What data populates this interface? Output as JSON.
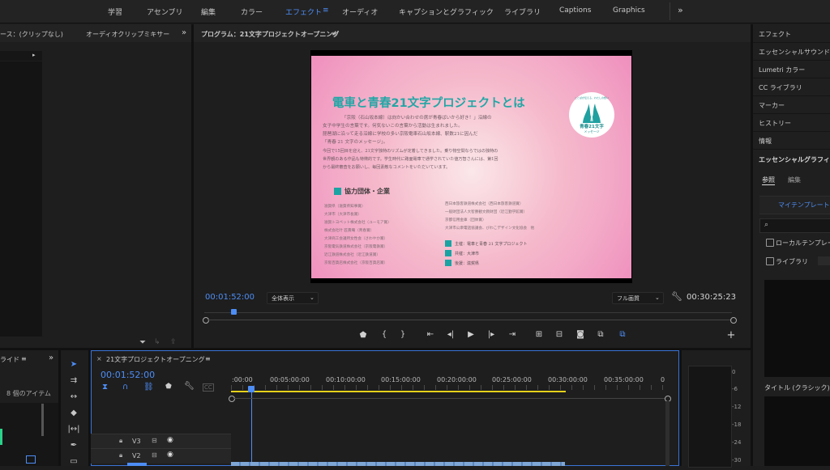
{
  "workspaces": [
    "学習",
    "アセンブリ",
    "編集",
    "カラー",
    "エフェクト",
    "オーディオ",
    "キャプションとグラフィック",
    "ライブラリ",
    "Captions",
    "Graphics"
  ],
  "active_workspace": "エフェクト",
  "overflow_glyph": "»",
  "source_panel": {
    "title": "ース：(クリップなし)",
    "mixer_tab": "オーディオクリップミキサー"
  },
  "program": {
    "title": "プログラム：21文字プロジェクトオープニング",
    "timecode": "00:01:52:00",
    "fit": "全体表示",
    "quality": "フル画質",
    "duration": "00:30:25:23"
  },
  "slide": {
    "heading": "電車と青春21文字プロジェクトとは",
    "paragraph": [
      "「京阪（石山坂本線）は向かい合わせの席が青春ばいから好き！」沿線の",
      "女子中学生の言葉です。何気ないこの言葉から活動は生まれました。",
      "琵琶湖に沿って走る沿線に学校の多い京阪電車石山坂本線、駅数21に因んだ",
      "「青春 21 文字のメッセージ」。",
      "今回で15回目を迎え、21文字独特のリズムが定着してきました。乗り物空間ならではの独特の",
      "世界観のある作品も特徴的です。学生時代に路面電車で通学されていた値万智さんには、第1回",
      "から最終審査をお願いし、毎回素敵なコメントをいただいています。"
    ],
    "section": "協力団体・企業",
    "left_list": [
      "滋賀県（滋賀県知事賞）",
      "大津市（大津市長賞）",
      "滋賀トヨペット株式会社（ユーモア賞）",
      "株式会社叶 匠壽庵（青春賞）",
      "大津商工会議所女性会（さわやか賞）",
      "京阪電気鉄道株式会社（京阪電鉄賞）",
      "近江鉄道株式会社（近江鉄道賞）",
      "京阪百貨店株式会社（京阪百貨店賞）"
    ],
    "right_list": [
      "西日本旅客鉄道株式会社（西日本旅客鉄道賞）",
      "一般財団法人大智勝観文教財団（近江勤学館賞）",
      "京都信用金庫（団体賞）",
      "大津市公衆電話協議会、びわこデザイン文化協会　他"
    ],
    "credits": [
      "主催：電車と青春 21 文字プロジェクト",
      "共催：大津市",
      "後援：滋賀県"
    ],
    "logo_caption": "青春21文字",
    "logo_sub": "メッセージ",
    "logo_arc": "ことばが伝える、わたしの想い"
  },
  "right_panel": {
    "items": [
      "エフェクト",
      "エッセンシャルサウンド",
      "Lumetri カラー",
      "CC ライブラリ",
      "マーカー",
      "ヒストリー",
      "情報"
    ],
    "essential_graphics": "エッセンシャルグラフィックス",
    "tabs": [
      "参照",
      "編集"
    ],
    "template_button": "マイテンプレート",
    "local_templates": "ローカルテンプレート",
    "library": "ライブラリ",
    "title_classic": "タイトル (クラシック)"
  },
  "project_panel": {
    "tab": "ライド",
    "items": "8 個のアイテム"
  },
  "timeline": {
    "title": "21文字プロジェクトオープニング",
    "timecode": "00:01:52:00",
    "ruler": [
      ":00:00",
      "00:05:00:00",
      "00:10:00:00",
      "00:15:00:00",
      "00:20:00:00",
      "00:25:00:00",
      "00:30:00:00",
      "00:35:00:00",
      "0"
    ],
    "tracks": [
      "V3",
      "V2"
    ]
  },
  "audio_meter": {
    "labels": [
      "0",
      "-6",
      "-12",
      "-18",
      "-24",
      "-30"
    ]
  },
  "colors": {
    "accent": "#4d8df5",
    "teal": "#1aa3a3",
    "slide_pink": "#f3a9c7",
    "heading": "#22a6a6"
  }
}
